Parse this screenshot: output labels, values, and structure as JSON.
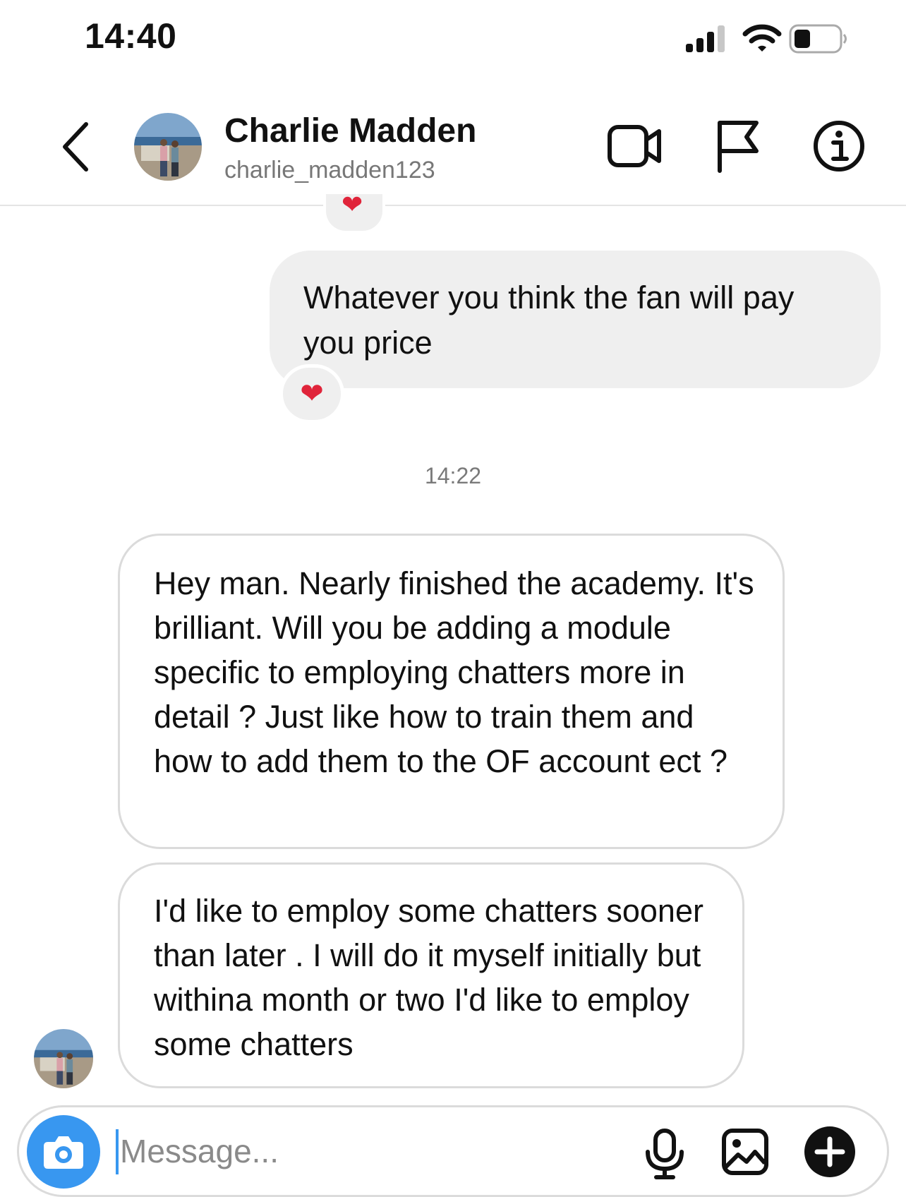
{
  "status_bar": {
    "time": "14:40"
  },
  "header": {
    "name": "Charlie Madden",
    "username": "charlie_madden123",
    "icons": [
      "back-chevron-icon",
      "video-call-icon",
      "flag-icon",
      "info-icon"
    ]
  },
  "messages": {
    "top_reaction": "❤",
    "outgoing": {
      "text": "Whatever you think the fan will pay you price",
      "reaction": "❤"
    },
    "timestamp": "14:22",
    "incoming": [
      {
        "text": "Hey man.  Nearly finished the academy.  It's brilliant.  Will you be adding a module specific to employing chatters more in detail ?  Just like how to train them and how to add them to the OF account ect ?"
      },
      {
        "text": "I'd like to employ some chatters sooner than later .  I will do it myself initially but withina month or two I'd like to employ some chatters"
      }
    ]
  },
  "composer": {
    "placeholder": "Message...",
    "icons": [
      "camera-icon",
      "microphone-icon",
      "gallery-icon",
      "plus-icon"
    ]
  },
  "colors": {
    "accent": "#3897f0",
    "bubble_outgoing": "#efefef",
    "bubble_border": "#dbdbdb",
    "heart": "#e0243a"
  }
}
